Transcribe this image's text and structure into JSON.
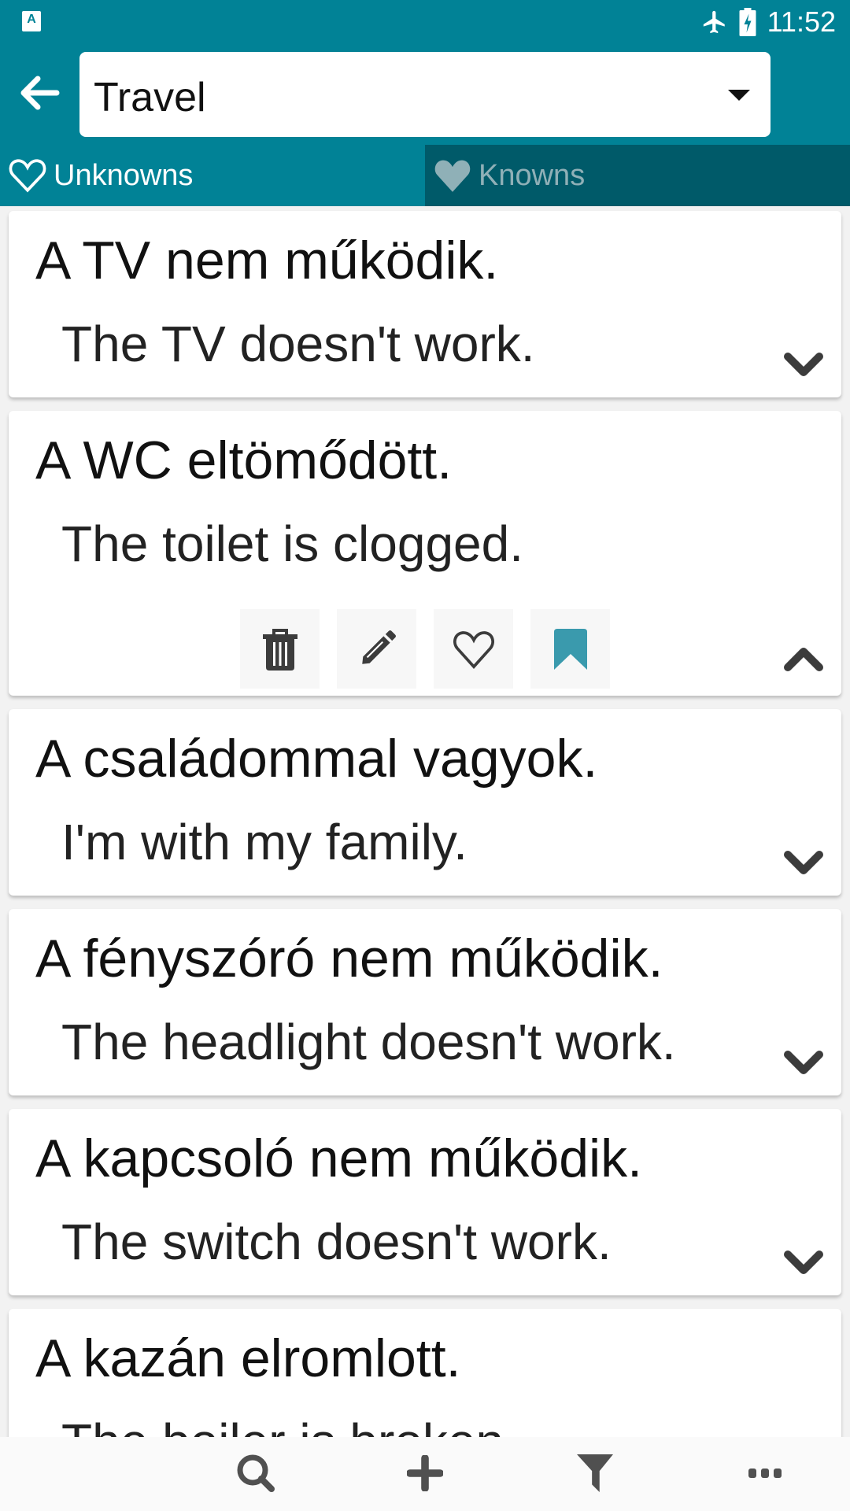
{
  "status_bar": {
    "app_icon_letter": "A",
    "time": "11:52",
    "icons": [
      "airplane-mode-icon",
      "battery-charging-icon"
    ]
  },
  "app_bar": {
    "back_icon": "arrow-left-icon",
    "category": {
      "selected": "Travel",
      "icon": "dropdown-caret-icon"
    }
  },
  "tabs": [
    {
      "label": "Unknowns",
      "icon": "heart-outline-icon",
      "active": true
    },
    {
      "label": "Knowns",
      "icon": "heart-filled-icon",
      "active": false
    }
  ],
  "phrases": [
    {
      "hu": "A TV nem működik.",
      "en": "The TV doesn't work.",
      "expanded": false
    },
    {
      "hu": "A WC eltömődött.",
      "en": "The toilet is clogged.",
      "expanded": true
    },
    {
      "hu": "A családommal vagyok.",
      "en": "I'm with my family.",
      "expanded": false
    },
    {
      "hu": "A fényszóró nem működik.",
      "en": "The headlight doesn't work.",
      "expanded": false
    },
    {
      "hu": "A kapcsoló nem működik.",
      "en": "The switch doesn't work.",
      "expanded": false
    },
    {
      "hu": "A kazán elromlott.",
      "en": "The boiler is broken.",
      "expanded": false
    }
  ],
  "card_actions": [
    "trash-icon",
    "pencil-icon",
    "heart-outline-icon",
    "bookmark-icon"
  ],
  "colors": {
    "primary": "#018296",
    "tab_inactive": "#005a69",
    "bookmark": "#3a9aad",
    "icon_dark": "#3c3c3c"
  },
  "bottom_bar": [
    "search-icon",
    "plus-icon",
    "filter-icon",
    "more-icon"
  ]
}
